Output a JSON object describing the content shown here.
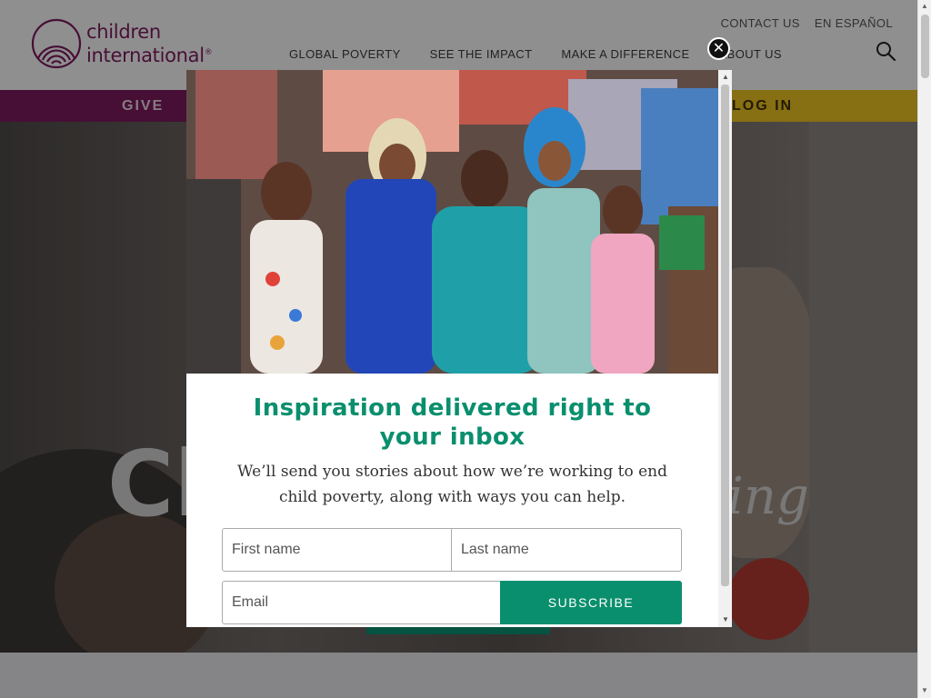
{
  "brand": {
    "logo_line1": "children",
    "logo_line2": "international",
    "logo_reg": "®",
    "primary_color": "#7b1a5c",
    "accent_color": "#0a8f6e",
    "cta_color": "#e8c022"
  },
  "header": {
    "utility_nav": [
      "CONTACT US",
      "EN ESPAÑOL"
    ],
    "main_nav": [
      "GLOBAL POVERTY",
      "SEE THE IMPACT",
      "MAKE A DIFFERENCE",
      "ABOUT US"
    ],
    "search_icon": "search-icon"
  },
  "action_bar": {
    "give_label": "GIVE",
    "login_label": "LOG IN"
  },
  "hero": {
    "text_left": "Ch",
    "text_right": "ing"
  },
  "modal": {
    "title": "Inspiration delivered right to your inbox",
    "subtitle": "We’ll send you stories about how we’re working to end child poverty, along with ways you can help.",
    "first_name_placeholder": "First name",
    "last_name_placeholder": "Last name",
    "email_placeholder": "Email",
    "subscribe_label": "SUBSCRIBE",
    "close_icon": "close-icon",
    "close_symbol": "✕"
  }
}
